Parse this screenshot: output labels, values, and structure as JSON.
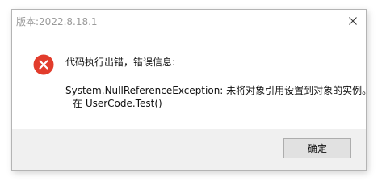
{
  "window": {
    "title": "版本:2022.8.18.1",
    "close_icon": "close-icon"
  },
  "message": {
    "icon": "error-icon",
    "icon_color": "#e23c2c",
    "line1": "代码执行出错，错误信息:",
    "line2": "System.NullReferenceException: 未将对象引用设置到对象的实例。",
    "line3": "在 UserCode.Test()"
  },
  "buttons": {
    "ok_label": "确定"
  }
}
